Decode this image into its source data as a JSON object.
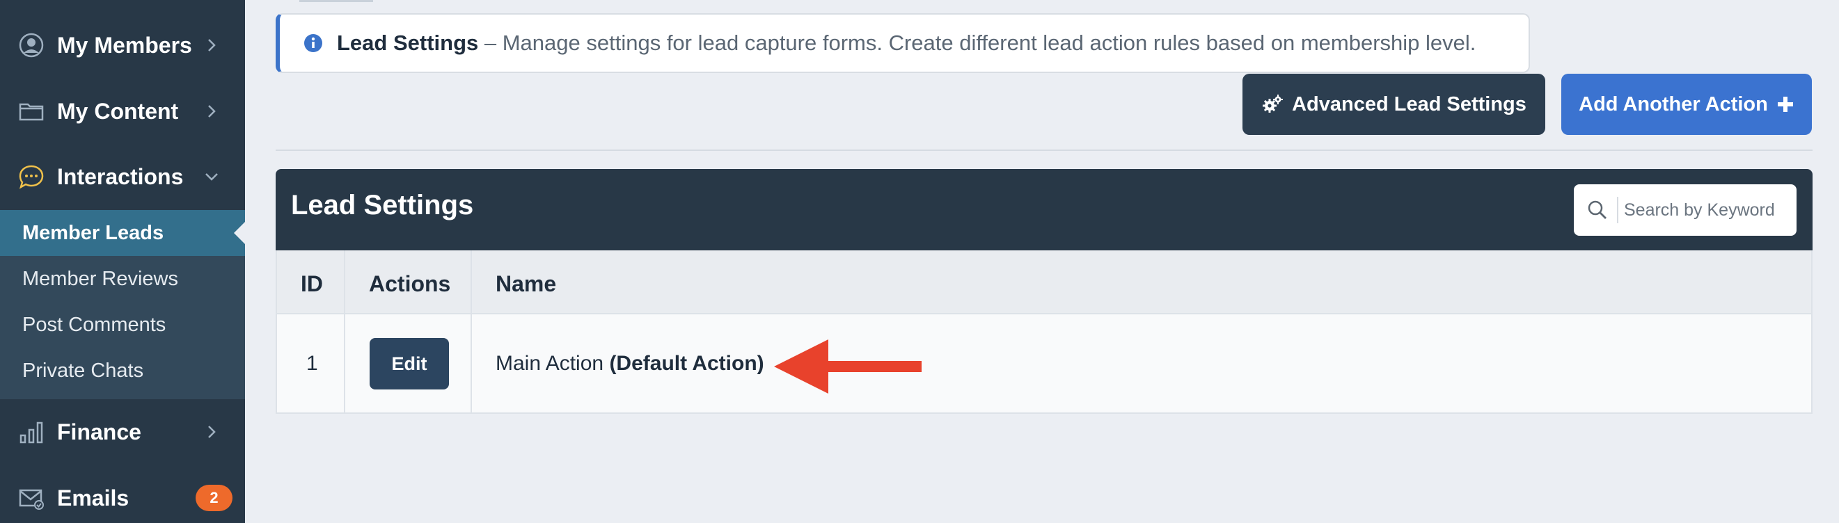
{
  "sidebar": {
    "items": [
      {
        "label": "My Members",
        "icon": "user-circle-icon"
      },
      {
        "label": "My Content",
        "icon": "folder-icon"
      },
      {
        "label": "Interactions",
        "icon": "chat-bubble-icon"
      },
      {
        "label": "Finance",
        "icon": "bar-chart-icon"
      },
      {
        "label": "Emails",
        "icon": "envelope-icon",
        "badge": "2"
      }
    ],
    "sub_items": [
      {
        "label": "Member Leads",
        "active": true
      },
      {
        "label": "Member Reviews"
      },
      {
        "label": "Post Comments"
      },
      {
        "label": "Private Chats"
      }
    ]
  },
  "notice": {
    "title": "Lead Settings",
    "description": " – Manage settings for lead capture forms. Create different lead action rules based on membership level."
  },
  "toolbar": {
    "advanced_label": "Advanced Lead Settings",
    "add_label": "Add Another Action"
  },
  "panel": {
    "title": "Lead Settings",
    "search_placeholder": "Search by Keyword"
  },
  "table": {
    "columns": [
      "ID",
      "Actions",
      "Name"
    ],
    "rows": [
      {
        "id": "1",
        "action_label": "Edit",
        "name": "Main Action",
        "name_suffix": "(Default Action)"
      }
    ]
  },
  "colors": {
    "sidebar": "#283847",
    "accent_blue": "#3b73d0",
    "active_item": "#336f8c",
    "badge": "#ee6a2b",
    "annotation_arrow": "#e8422c"
  }
}
